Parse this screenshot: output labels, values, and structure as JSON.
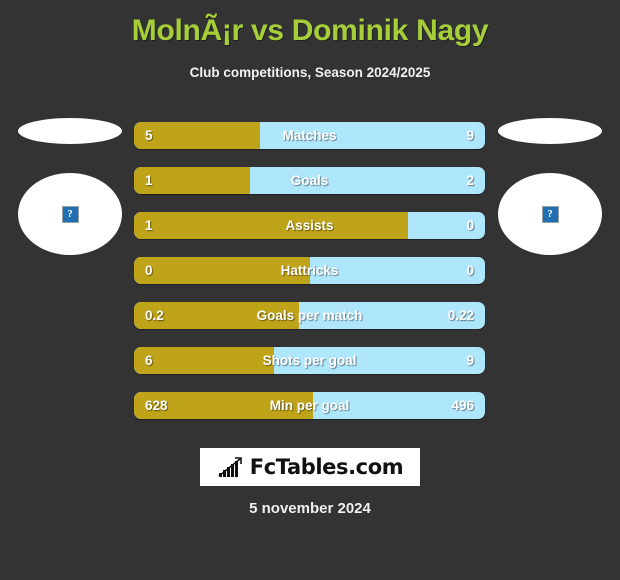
{
  "header": {
    "title": "MolnÃ¡r vs Dominik Nagy",
    "subtitle": "Club competitions, Season 2024/2025",
    "title_color": "#a6ce39"
  },
  "avatars": {
    "left": {
      "name": "left-player-photo",
      "icon": "broken-image-icon",
      "glyph": "?"
    },
    "right": {
      "name": "right-player-photo",
      "icon": "broken-image-icon",
      "glyph": "?"
    }
  },
  "colors": {
    "home_bar": "#bfa318",
    "away_bar": "#aee6fb",
    "background": "#333333",
    "text": "#ffffff"
  },
  "chart_data": {
    "type": "bar",
    "title": "MolnÃ¡r vs Dominik Nagy",
    "subtitle": "Club competitions, Season 2024/2025",
    "orientation": "horizontal-diverging",
    "series": [
      {
        "name": "MolnÃ¡r",
        "color": "#bfa318",
        "values": [
          5,
          1,
          1,
          0,
          0.2,
          6,
          628
        ]
      },
      {
        "name": "Dominik Nagy",
        "color": "#aee6fb",
        "values": [
          9,
          2,
          0,
          0,
          0.22,
          9,
          496
        ]
      }
    ],
    "categories": [
      "Matches",
      "Goals",
      "Assists",
      "Hattricks",
      "Goals per match",
      "Shots per goal",
      "Min per goal"
    ],
    "rows": [
      {
        "label": "Matches",
        "home": "5",
        "away": "9",
        "home_pct": 36
      },
      {
        "label": "Goals",
        "home": "1",
        "away": "2",
        "home_pct": 33
      },
      {
        "label": "Assists",
        "home": "1",
        "away": "0",
        "home_pct": 78
      },
      {
        "label": "Hattricks",
        "home": "0",
        "away": "0",
        "home_pct": 50
      },
      {
        "label": "Goals per match",
        "home": "0.2",
        "away": "0.22",
        "home_pct": 47
      },
      {
        "label": "Shots per goal",
        "home": "6",
        "away": "9",
        "home_pct": 40
      },
      {
        "label": "Min per goal",
        "home": "628",
        "away": "496",
        "home_pct": 51
      }
    ],
    "legend_position": "none",
    "grid": false
  },
  "footer": {
    "logo_text": "FcTables.com",
    "logo_icon": "bar-chart-arrow-icon",
    "date": "5 november 2024"
  }
}
